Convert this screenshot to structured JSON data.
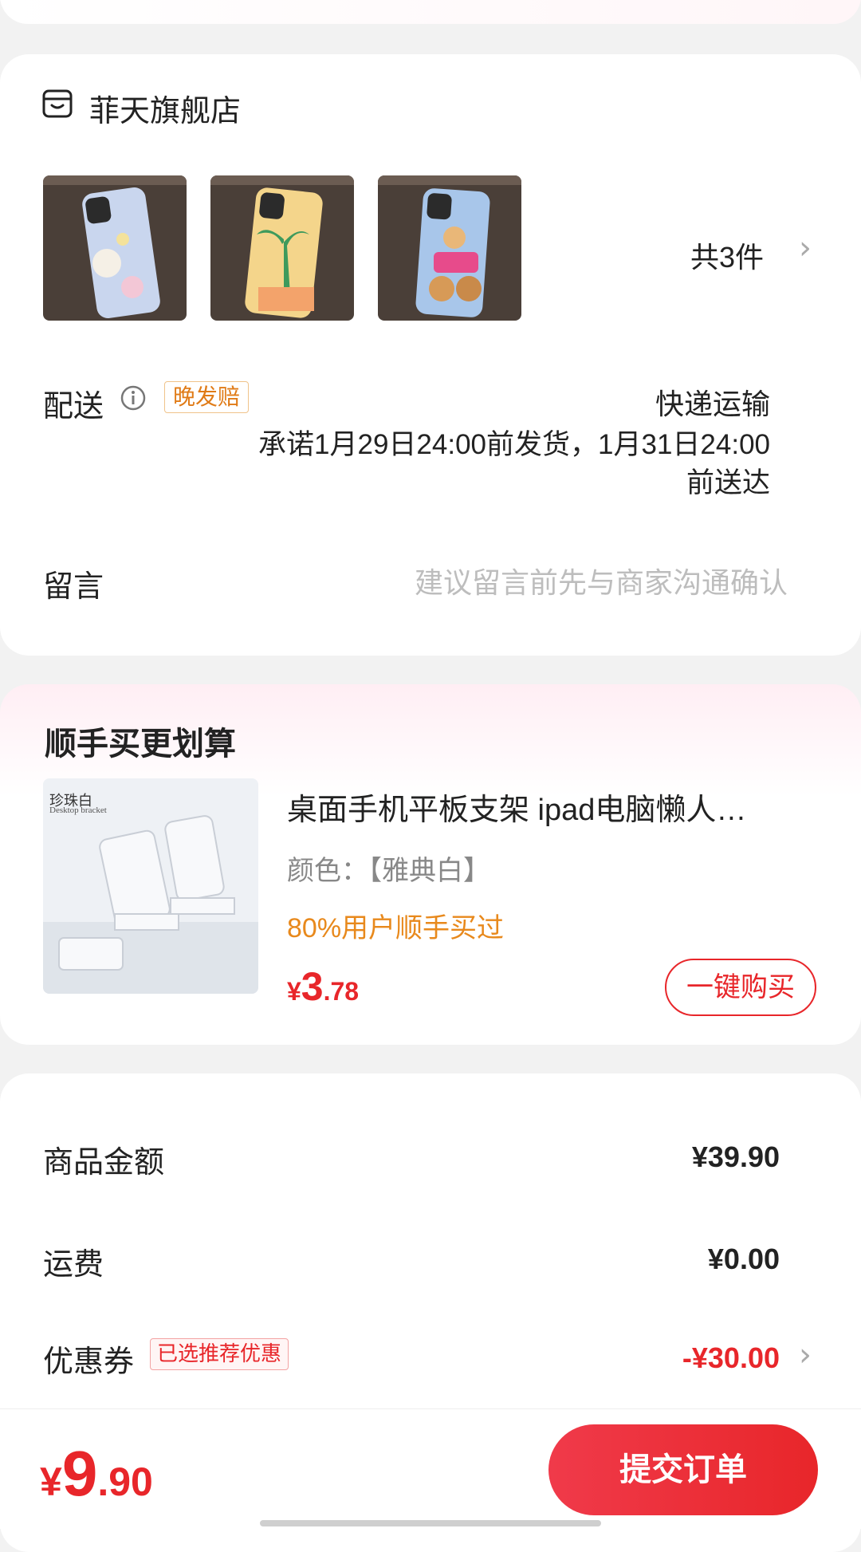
{
  "shop": {
    "name": "菲天旗舰店",
    "count_label": "共3件"
  },
  "delivery": {
    "label": "配送",
    "badge": "晚发赔",
    "method": "快递运输",
    "promise": "承诺1月29日24:00前发货，1月31日24:00前送达"
  },
  "message": {
    "label": "留言",
    "placeholder": "建议留言前先与商家沟通确认"
  },
  "upsell": {
    "title": "顺手买更划算",
    "image_text": {
      "main": "珍珠白",
      "sub": "Desktop bracket"
    },
    "product_name": "桌面手机平板支架 ipad电脑懒人…",
    "color": "颜色：【雅典白】",
    "stat": "80%用户顺手买过",
    "price": {
      "symbol": "¥",
      "int": "3",
      "dec": ".78"
    },
    "buy_label": "一键购买"
  },
  "summary": {
    "goods_label": "商品金额",
    "goods_value": "¥39.90",
    "shipping_label": "运费",
    "shipping_value": "¥0.00",
    "coupon_label": "优惠券",
    "coupon_badge": "已选推荐优惠",
    "coupon_value": "-¥30.00"
  },
  "footer": {
    "total": {
      "symbol": "¥",
      "int": "9",
      "dec": ".90"
    },
    "submit_label": "提交订单"
  },
  "icons": {
    "shop": "shop-icon",
    "info": "info-icon",
    "chevron": "chevron-right-icon"
  },
  "colors": {
    "accent": "#e8262a",
    "orange": "#e8891c"
  }
}
